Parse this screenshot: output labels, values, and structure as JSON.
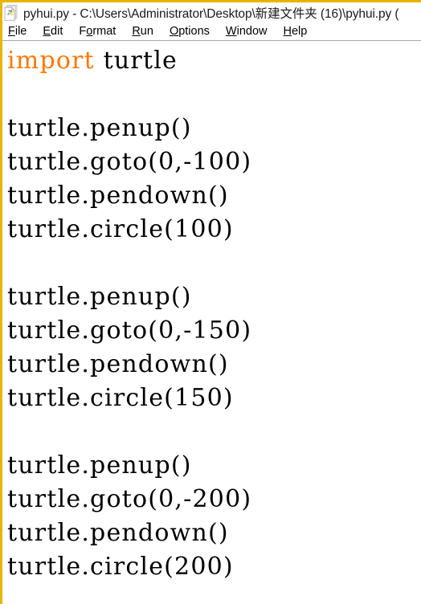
{
  "window": {
    "border_color": "#e8b400",
    "background": "#ffffff"
  },
  "titlebar": {
    "icon": "python-file-icon",
    "title": "pyhui.py - C:\\Users\\Administrator\\Desktop\\新建文件夹 (16)\\pyhui.py ("
  },
  "menubar": {
    "items": [
      {
        "label": "File",
        "mnemonic": "F",
        "before": "",
        "after": "ile"
      },
      {
        "label": "Edit",
        "mnemonic": "E",
        "before": "",
        "after": "dit"
      },
      {
        "label": "Format",
        "mnemonic": "o",
        "before": "F",
        "after": "rmat"
      },
      {
        "label": "Run",
        "mnemonic": "R",
        "before": "",
        "after": "un"
      },
      {
        "label": "Options",
        "mnemonic": "O",
        "before": "",
        "after": "ptions"
      },
      {
        "label": "Window",
        "mnemonic": "W",
        "before": "",
        "after": "indow"
      },
      {
        "label": "Help",
        "mnemonic": "H",
        "before": "",
        "after": "elp"
      }
    ]
  },
  "editor": {
    "language": "python",
    "keyword_color": "#ff7700",
    "text_color": "#000000",
    "lines": [
      {
        "n": 1,
        "keyword": "import",
        "rest": " turtle"
      },
      {
        "n": 2,
        "keyword": "",
        "rest": ""
      },
      {
        "n": 3,
        "keyword": "",
        "rest": "turtle.penup()"
      },
      {
        "n": 4,
        "keyword": "",
        "rest": "turtle.goto(0,-100)"
      },
      {
        "n": 5,
        "keyword": "",
        "rest": "turtle.pendown()"
      },
      {
        "n": 6,
        "keyword": "",
        "rest": "turtle.circle(100)"
      },
      {
        "n": 7,
        "keyword": "",
        "rest": ""
      },
      {
        "n": 8,
        "keyword": "",
        "rest": "turtle.penup()"
      },
      {
        "n": 9,
        "keyword": "",
        "rest": "turtle.goto(0,-150)"
      },
      {
        "n": 10,
        "keyword": "",
        "rest": "turtle.pendown()"
      },
      {
        "n": 11,
        "keyword": "",
        "rest": "turtle.circle(150)"
      },
      {
        "n": 12,
        "keyword": "",
        "rest": ""
      },
      {
        "n": 13,
        "keyword": "",
        "rest": "turtle.penup()"
      },
      {
        "n": 14,
        "keyword": "",
        "rest": "turtle.goto(0,-200)"
      },
      {
        "n": 15,
        "keyword": "",
        "rest": "turtle.pendown()"
      },
      {
        "n": 16,
        "keyword": "",
        "rest": "turtle.circle(200)"
      }
    ]
  }
}
